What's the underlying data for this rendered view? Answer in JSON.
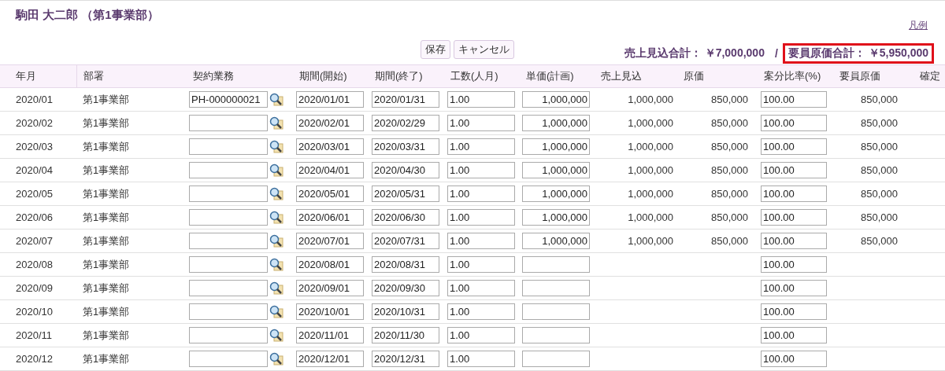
{
  "title": "駒田 大二郎 （第1事業部）",
  "legend_link": "凡例",
  "buttons": [
    "保存",
    "キャンセル"
  ],
  "totals": [
    {
      "text": "売上見込合計： ￥7,000,000",
      "highlighted": false
    },
    {
      "text": "要員原価合計： ￥5,950,000",
      "highlighted": true
    }
  ],
  "totals_separator": "/",
  "table": {
    "columns": [
      "年月",
      "部署",
      "契約業務",
      "期間(開始)",
      "期間(終了)",
      "工数(人月)",
      "単価(計画)",
      "売上見込",
      "原価",
      "案分比率(%)",
      "要員原価",
      "確定"
    ],
    "rows": [
      {
        "month": "2020/01",
        "dept": "第1事業部",
        "contract": "PH-000000021",
        "start": "2020/01/01",
        "end": "2020/01/31",
        "manmonths": "1.00",
        "unit_price": "1,000,000",
        "sales": "1,000,000",
        "cost": "850,000",
        "ratio": "100.00",
        "member_cost": "850,000"
      },
      {
        "month": "2020/02",
        "dept": "第1事業部",
        "start": "2020/02/01",
        "end": "2020/02/29",
        "manmonths": "1.00",
        "unit_price": "1,000,000",
        "sales": "1,000,000",
        "cost": "850,000",
        "ratio": "100.00",
        "member_cost": "850,000"
      },
      {
        "month": "2020/03",
        "dept": "第1事業部",
        "start": "2020/03/01",
        "end": "2020/03/31",
        "manmonths": "1.00",
        "unit_price": "1,000,000",
        "sales": "1,000,000",
        "cost": "850,000",
        "ratio": "100.00",
        "member_cost": "850,000"
      },
      {
        "month": "2020/04",
        "dept": "第1事業部",
        "start": "2020/04/01",
        "end": "2020/04/30",
        "manmonths": "1.00",
        "unit_price": "1,000,000",
        "sales": "1,000,000",
        "cost": "850,000",
        "ratio": "100.00",
        "member_cost": "850,000"
      },
      {
        "month": "2020/05",
        "dept": "第1事業部",
        "start": "2020/05/01",
        "end": "2020/05/31",
        "manmonths": "1.00",
        "unit_price": "1,000,000",
        "sales": "1,000,000",
        "cost": "850,000",
        "ratio": "100.00",
        "member_cost": "850,000"
      },
      {
        "month": "2020/06",
        "dept": "第1事業部",
        "start": "2020/06/01",
        "end": "2020/06/30",
        "manmonths": "1.00",
        "unit_price": "1,000,000",
        "sales": "1,000,000",
        "cost": "850,000",
        "ratio": "100.00",
        "member_cost": "850,000"
      },
      {
        "month": "2020/07",
        "dept": "第1事業部",
        "start": "2020/07/01",
        "end": "2020/07/31",
        "manmonths": "1.00",
        "unit_price": "1,000,000",
        "sales": "1,000,000",
        "cost": "850,000",
        "ratio": "100.00",
        "member_cost": "850,000"
      },
      {
        "month": "2020/08",
        "dept": "第1事業部",
        "start": "2020/08/01",
        "end": "2020/08/31",
        "manmonths": "1.00",
        "ratio": "100.00"
      },
      {
        "month": "2020/09",
        "dept": "第1事業部",
        "start": "2020/09/01",
        "end": "2020/09/30",
        "manmonths": "1.00",
        "ratio": "100.00"
      },
      {
        "month": "2020/10",
        "dept": "第1事業部",
        "start": "2020/10/01",
        "end": "2020/10/31",
        "manmonths": "1.00",
        "ratio": "100.00"
      },
      {
        "month": "2020/11",
        "dept": "第1事業部",
        "start": "2020/11/01",
        "end": "2020/11/30",
        "manmonths": "1.00",
        "ratio": "100.00"
      },
      {
        "month": "2020/12",
        "dept": "第1事業部",
        "start": "2020/12/01",
        "end": "2020/12/31",
        "manmonths": "1.00",
        "ratio": "100.00"
      }
    ]
  }
}
